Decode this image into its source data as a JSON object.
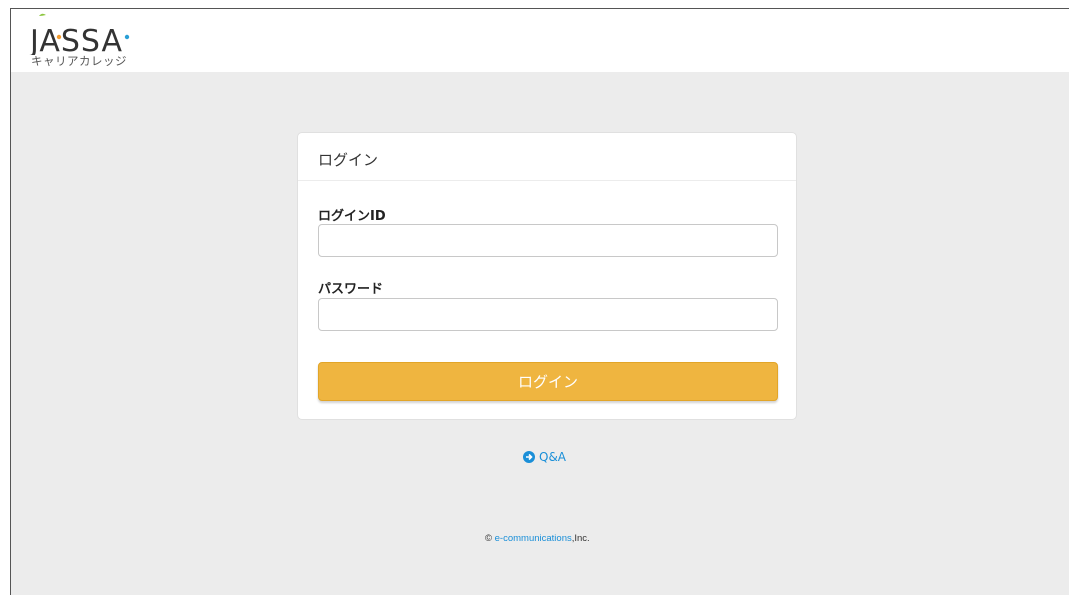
{
  "header": {
    "logo_text": "JASSA",
    "logo_sub": "キャリアカレッジ",
    "logo_colors": {
      "main": "#333333",
      "leaf": "#8cc63f",
      "dot": "#f29a2e",
      "dot2": "#2a9fd6"
    }
  },
  "login": {
    "title": "ログイン",
    "id_label": "ログインID",
    "id_value": "",
    "password_label": "パスワード",
    "password_value": "",
    "submit_label": "ログイン"
  },
  "links": {
    "qa_label": "Q&A",
    "qa_icon": "arrow-circle-right-icon"
  },
  "footer": {
    "copyright_symbol": "©",
    "company_link": "e-communications",
    "suffix": ",Inc."
  },
  "colors": {
    "accent_button": "#efb540",
    "link": "#1a8fd8",
    "background": "#ececec"
  }
}
